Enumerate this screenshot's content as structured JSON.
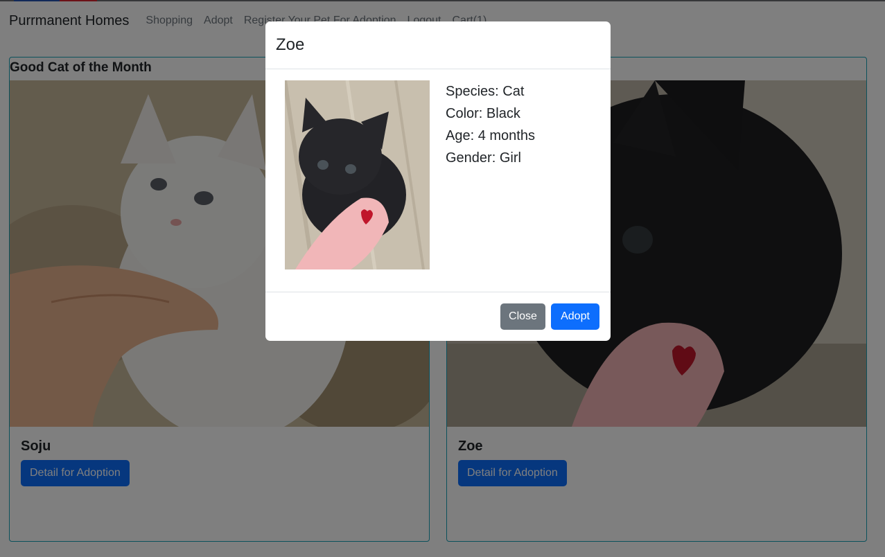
{
  "navbar": {
    "brand": "Purrmanent Homes",
    "links": [
      "Shopping",
      "Adopt",
      "Register Your Pet For Adoption",
      "Logout",
      "Cart(1)"
    ]
  },
  "section_title": "Good Cat of the Month",
  "cards": [
    {
      "name": "Soju",
      "button_label": "Detail for Adoption"
    },
    {
      "name": "Zoe",
      "button_label": "Detail for Adoption"
    }
  ],
  "modal": {
    "title": "Zoe",
    "info": [
      "Species: Cat",
      "Color: Black",
      "Age: 4 months",
      "Gender: Girl"
    ],
    "close_label": "Close",
    "adopt_label": "Adopt"
  },
  "colors": {
    "primary": "#0d6efd",
    "secondary": "#6c757d",
    "card_border": "#17a2b8"
  }
}
